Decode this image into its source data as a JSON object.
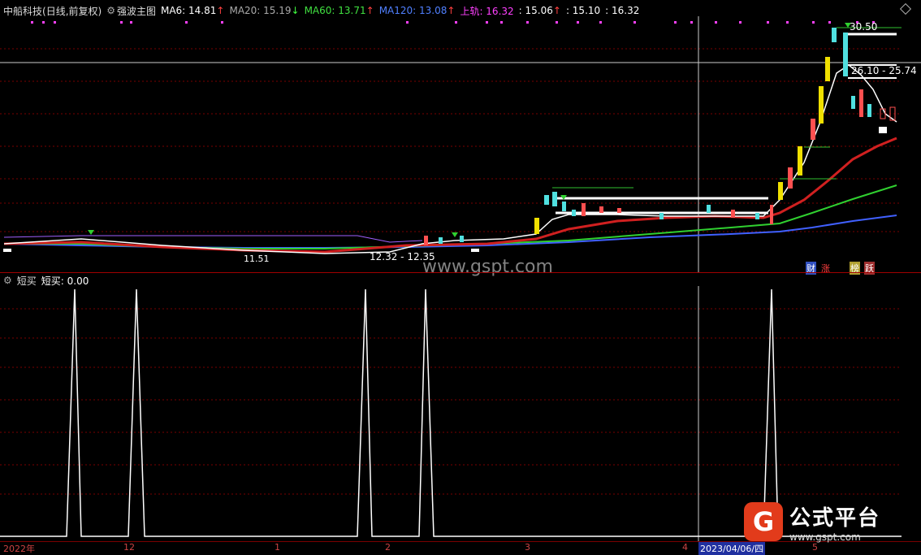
{
  "header": {
    "stock": "中船科技",
    "mode": "(日线,前复权)",
    "indicator": "强波主图",
    "ma6": "MA6: 14.81",
    "ma6_arrow": "↑",
    "ma20": "MA20: 15.19",
    "ma20_arrow": "↓",
    "ma60": "MA60: 13.71",
    "ma60_arrow": "↑",
    "ma120": "MA120: 13.08",
    "ma120_arrow": "↑",
    "upper": "上轨: 16.32",
    "v1": ": 15.06",
    "v1_arrow": "↑",
    "v2": ": 15.10",
    "v3": ": 16.32"
  },
  "price_labels": {
    "high_label": "30.50",
    "range_label": "26.10 - 25.74",
    "low_label": "11.51",
    "mid_label": "12.32 - 12.35"
  },
  "tags": {
    "cai": "财",
    "zhang": "涨",
    "bang": "榜",
    "yue": "跃"
  },
  "watermark": "www.gspt.com",
  "indicator": {
    "name": "短买",
    "value": "短买: 0.00"
  },
  "dates": {
    "d2022": "2022年",
    "d12": "12",
    "d1": "1",
    "d2": "2",
    "d3": "3",
    "d4": "4",
    "cursor": "2023/04/06/四",
    "d5": "5"
  },
  "logo": {
    "badge": "G",
    "title": "公式平台",
    "url": "www.gspt.com"
  },
  "colors": {
    "ma6": "#ffffff",
    "ma20": "#ff3030",
    "ma60": "#30d030",
    "ma120": "#4060ff",
    "upper": "#ff40ff",
    "up_candle": "#ff5050",
    "down_candle": "#50e0e0",
    "yellow_candle": "#f0e000"
  }
}
